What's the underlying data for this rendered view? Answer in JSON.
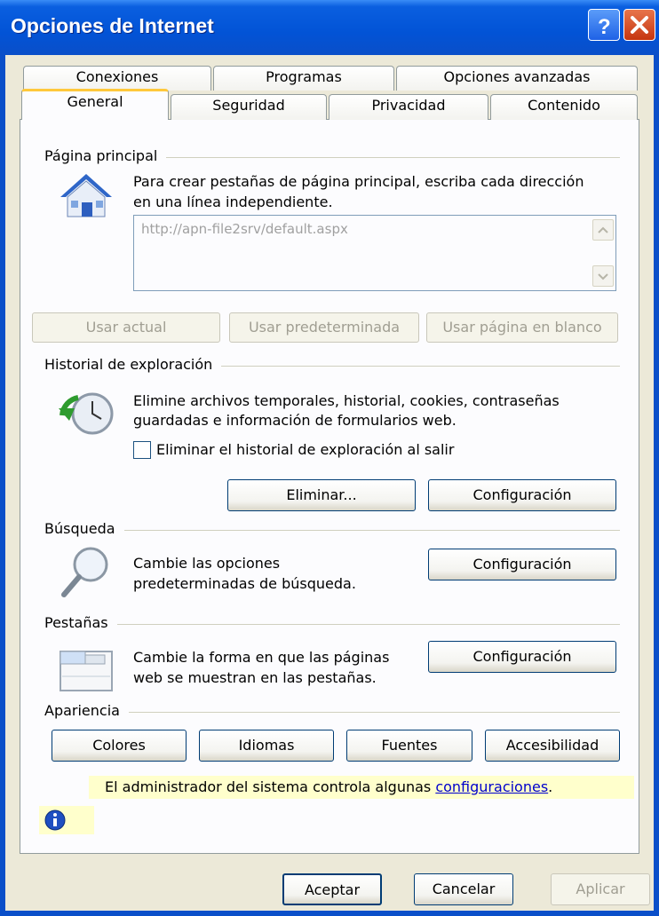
{
  "window": {
    "title": "Opciones de Internet"
  },
  "tabs": {
    "row1": [
      "Conexiones",
      "Programas",
      "Opciones avanzadas"
    ],
    "row2": [
      "General",
      "Seguridad",
      "Privacidad",
      "Contenido"
    ]
  },
  "home": {
    "group_label": "Página principal",
    "desc_line1": "Para crear pestañas de página principal, escriba cada dirección",
    "desc_line2": "en una línea independiente.",
    "url": "http://apn-file2srv/default.aspx",
    "btn_current": "Usar actual",
    "btn_default": "Usar predeterminada",
    "btn_blank": "Usar página en blanco"
  },
  "history": {
    "group_label": "Historial de exploración",
    "desc_line1": "Elimine archivos temporales, historial, cookies, contraseñas",
    "desc_line2": "guardadas e información de formularios web.",
    "checkbox_label": "Eliminar el historial de exploración al salir",
    "btn_delete": "Eliminar...",
    "btn_settings": "Configuración"
  },
  "search": {
    "group_label": "Búsqueda",
    "desc_line1": "Cambie las opciones",
    "desc_line2": "predeterminadas de búsqueda.",
    "btn_settings": "Configuración"
  },
  "tabs_section": {
    "group_label": "Pestañas",
    "desc_line1": "Cambie la forma en que las páginas",
    "desc_line2": "web se muestran en las pestañas.",
    "btn_settings": "Configuración"
  },
  "appearance": {
    "group_label": "Apariencia",
    "btn_colors": "Colores",
    "btn_languages": "Idiomas",
    "btn_fonts": "Fuentes",
    "btn_accessibility": "Accesibilidad"
  },
  "notice": {
    "text": "El administrador del sistema controla algunas ",
    "link": "configuraciones",
    "suffix": "."
  },
  "footer": {
    "ok": "Aceptar",
    "cancel": "Cancelar",
    "apply": "Aplicar"
  }
}
